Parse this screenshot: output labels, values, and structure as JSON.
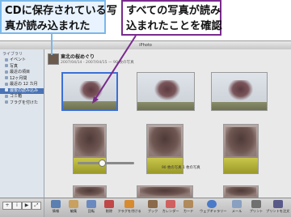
{
  "callouts": {
    "left": {
      "line1": "CDに保存されている写",
      "line2": "真が読み込まれた"
    },
    "right": {
      "line1": "すべての写真が読み",
      "line2": "込まれたことを確認"
    }
  },
  "window": {
    "title": "iPhoto"
  },
  "sidebar": {
    "header": "ライブラリ",
    "items": [
      {
        "label": "イベント"
      },
      {
        "label": "写真"
      },
      {
        "label": "最近の項目"
      },
      {
        "label": "12ヶ月間"
      },
      {
        "label": "最近の 12 カ月"
      },
      {
        "label": "最後の読み込み"
      },
      {
        "label": "ゴミ箱"
      },
      {
        "label": "フラグを付けた"
      }
    ]
  },
  "event": {
    "title": "東北の桜めぐり",
    "subtitle": "2007/04/14 - 2007/04/15 — 90 枚の写真"
  },
  "toolbar": {
    "buttons": [
      {
        "label": "情報"
      },
      {
        "label": "編集"
      },
      {
        "label": "回転"
      },
      {
        "label": "削除"
      },
      {
        "label": "フラグを付ける"
      },
      {
        "label": "ブック"
      },
      {
        "label": "カレンダー"
      },
      {
        "label": "カード"
      },
      {
        "label": "ウェブギャラリー"
      },
      {
        "label": "メール"
      },
      {
        "label": "プリント"
      },
      {
        "label": "プリントを注文"
      }
    ],
    "count_text": "90 枚の写真 1 枚の写真"
  },
  "colors": {
    "callout_left_border": "#7bb8e8",
    "callout_right_border": "#7a2a8c",
    "selection": "#4a73b5"
  }
}
